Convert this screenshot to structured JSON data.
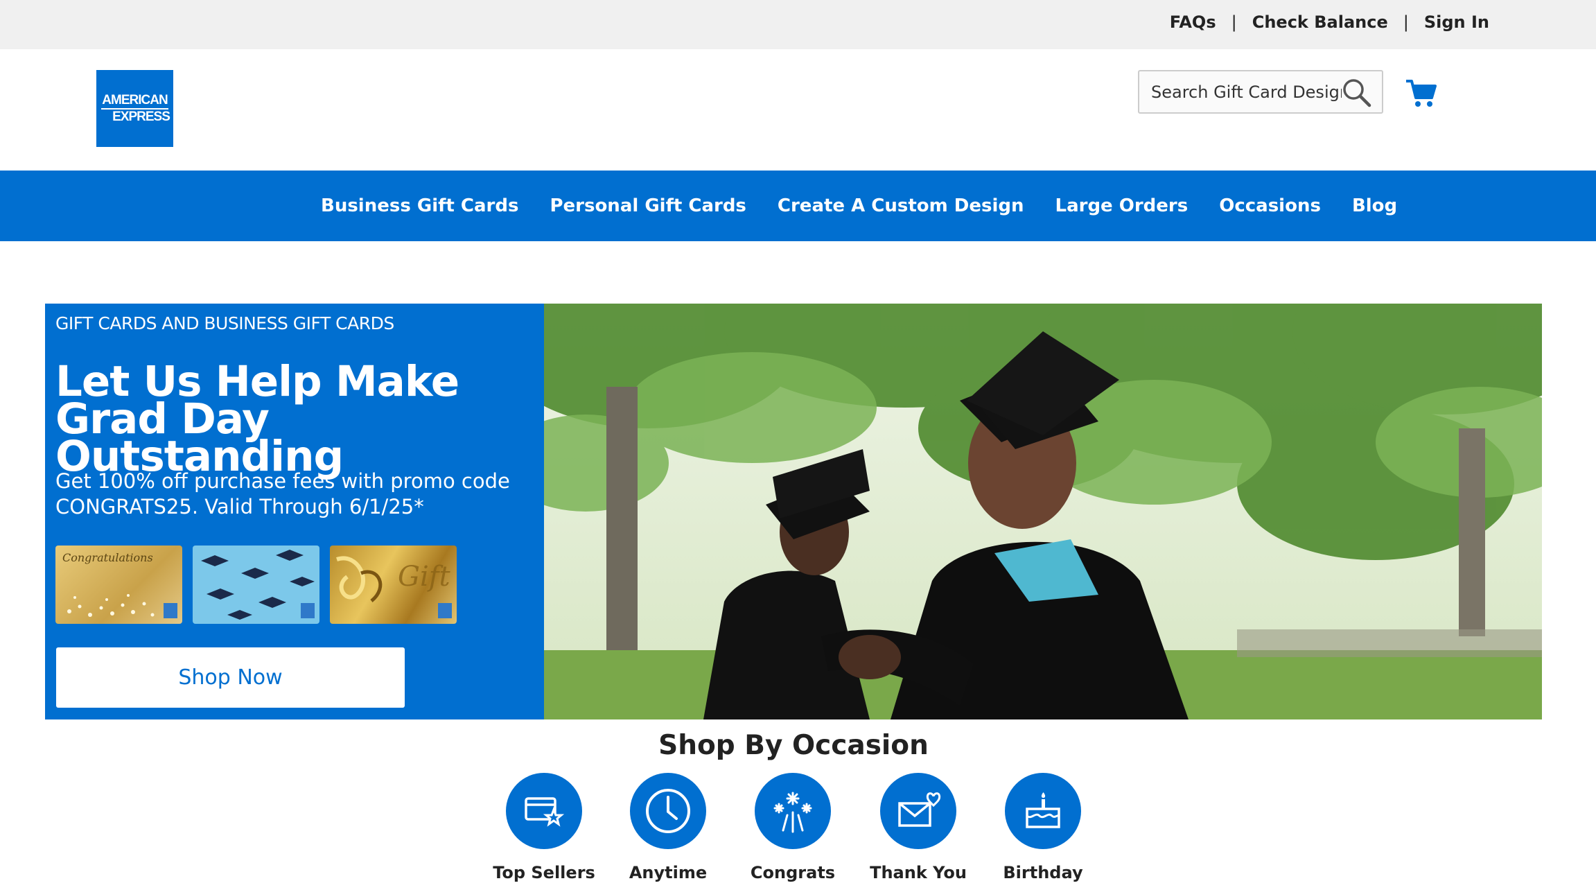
{
  "utility": {
    "faqs": "FAQs",
    "check_balance": "Check Balance",
    "sign_in": "Sign In",
    "separator": "|"
  },
  "brand": {
    "logo_line1": "AMERICAN",
    "logo_line2": "EXPRESS",
    "color": "#016fd0"
  },
  "search": {
    "placeholder": "Search Gift Card Designs",
    "icon": "search-icon"
  },
  "cart": {
    "icon": "cart-icon"
  },
  "nav": {
    "items": [
      {
        "label": "Business Gift Cards"
      },
      {
        "label": "Personal Gift Cards"
      },
      {
        "label": "Create A Custom Design"
      },
      {
        "label": "Large Orders"
      },
      {
        "label": "Occasions"
      },
      {
        "label": "Blog"
      }
    ]
  },
  "hero": {
    "eyebrow": "GIFT CARDS AND BUSINESS GIFT CARDS",
    "headline": "Let Us Help Make Grad Day Outstanding",
    "subtext": "Get 100% off purchase fees with promo code CONGRATS25. Valid Through 6/1/25*",
    "card1_script": "Congratulations",
    "card3_script": "Gift",
    "cta": "Shop Now"
  },
  "occasions": {
    "title": "Shop By Occasion",
    "items": [
      {
        "label": "Top Sellers",
        "icon": "top-sellers-icon"
      },
      {
        "label": "Anytime",
        "icon": "clock-icon"
      },
      {
        "label": "Congrats",
        "icon": "fireworks-icon"
      },
      {
        "label": "Thank You",
        "icon": "envelope-heart-icon"
      },
      {
        "label": "Birthday",
        "icon": "birthday-cake-icon"
      }
    ]
  }
}
